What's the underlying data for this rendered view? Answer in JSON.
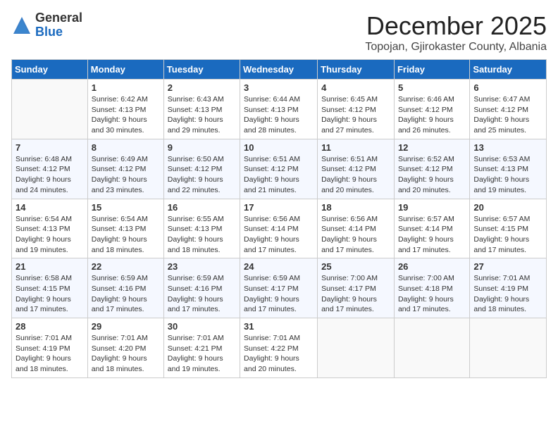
{
  "logo": {
    "general": "General",
    "blue": "Blue"
  },
  "title": "December 2025",
  "location": "Topojan, Gjirokaster County, Albania",
  "headers": [
    "Sunday",
    "Monday",
    "Tuesday",
    "Wednesday",
    "Thursday",
    "Friday",
    "Saturday"
  ],
  "weeks": [
    [
      {
        "day": "",
        "sunrise": "",
        "sunset": "",
        "daylight": ""
      },
      {
        "day": "1",
        "sunrise": "Sunrise: 6:42 AM",
        "sunset": "Sunset: 4:13 PM",
        "daylight": "Daylight: 9 hours and 30 minutes."
      },
      {
        "day": "2",
        "sunrise": "Sunrise: 6:43 AM",
        "sunset": "Sunset: 4:13 PM",
        "daylight": "Daylight: 9 hours and 29 minutes."
      },
      {
        "day": "3",
        "sunrise": "Sunrise: 6:44 AM",
        "sunset": "Sunset: 4:13 PM",
        "daylight": "Daylight: 9 hours and 28 minutes."
      },
      {
        "day": "4",
        "sunrise": "Sunrise: 6:45 AM",
        "sunset": "Sunset: 4:12 PM",
        "daylight": "Daylight: 9 hours and 27 minutes."
      },
      {
        "day": "5",
        "sunrise": "Sunrise: 6:46 AM",
        "sunset": "Sunset: 4:12 PM",
        "daylight": "Daylight: 9 hours and 26 minutes."
      },
      {
        "day": "6",
        "sunrise": "Sunrise: 6:47 AM",
        "sunset": "Sunset: 4:12 PM",
        "daylight": "Daylight: 9 hours and 25 minutes."
      }
    ],
    [
      {
        "day": "7",
        "sunrise": "Sunrise: 6:48 AM",
        "sunset": "Sunset: 4:12 PM",
        "daylight": "Daylight: 9 hours and 24 minutes."
      },
      {
        "day": "8",
        "sunrise": "Sunrise: 6:49 AM",
        "sunset": "Sunset: 4:12 PM",
        "daylight": "Daylight: 9 hours and 23 minutes."
      },
      {
        "day": "9",
        "sunrise": "Sunrise: 6:50 AM",
        "sunset": "Sunset: 4:12 PM",
        "daylight": "Daylight: 9 hours and 22 minutes."
      },
      {
        "day": "10",
        "sunrise": "Sunrise: 6:51 AM",
        "sunset": "Sunset: 4:12 PM",
        "daylight": "Daylight: 9 hours and 21 minutes."
      },
      {
        "day": "11",
        "sunrise": "Sunrise: 6:51 AM",
        "sunset": "Sunset: 4:12 PM",
        "daylight": "Daylight: 9 hours and 20 minutes."
      },
      {
        "day": "12",
        "sunrise": "Sunrise: 6:52 AM",
        "sunset": "Sunset: 4:12 PM",
        "daylight": "Daylight: 9 hours and 20 minutes."
      },
      {
        "day": "13",
        "sunrise": "Sunrise: 6:53 AM",
        "sunset": "Sunset: 4:13 PM",
        "daylight": "Daylight: 9 hours and 19 minutes."
      }
    ],
    [
      {
        "day": "14",
        "sunrise": "Sunrise: 6:54 AM",
        "sunset": "Sunset: 4:13 PM",
        "daylight": "Daylight: 9 hours and 19 minutes."
      },
      {
        "day": "15",
        "sunrise": "Sunrise: 6:54 AM",
        "sunset": "Sunset: 4:13 PM",
        "daylight": "Daylight: 9 hours and 18 minutes."
      },
      {
        "day": "16",
        "sunrise": "Sunrise: 6:55 AM",
        "sunset": "Sunset: 4:13 PM",
        "daylight": "Daylight: 9 hours and 18 minutes."
      },
      {
        "day": "17",
        "sunrise": "Sunrise: 6:56 AM",
        "sunset": "Sunset: 4:14 PM",
        "daylight": "Daylight: 9 hours and 17 minutes."
      },
      {
        "day": "18",
        "sunrise": "Sunrise: 6:56 AM",
        "sunset": "Sunset: 4:14 PM",
        "daylight": "Daylight: 9 hours and 17 minutes."
      },
      {
        "day": "19",
        "sunrise": "Sunrise: 6:57 AM",
        "sunset": "Sunset: 4:14 PM",
        "daylight": "Daylight: 9 hours and 17 minutes."
      },
      {
        "day": "20",
        "sunrise": "Sunrise: 6:57 AM",
        "sunset": "Sunset: 4:15 PM",
        "daylight": "Daylight: 9 hours and 17 minutes."
      }
    ],
    [
      {
        "day": "21",
        "sunrise": "Sunrise: 6:58 AM",
        "sunset": "Sunset: 4:15 PM",
        "daylight": "Daylight: 9 hours and 17 minutes."
      },
      {
        "day": "22",
        "sunrise": "Sunrise: 6:59 AM",
        "sunset": "Sunset: 4:16 PM",
        "daylight": "Daylight: 9 hours and 17 minutes."
      },
      {
        "day": "23",
        "sunrise": "Sunrise: 6:59 AM",
        "sunset": "Sunset: 4:16 PM",
        "daylight": "Daylight: 9 hours and 17 minutes."
      },
      {
        "day": "24",
        "sunrise": "Sunrise: 6:59 AM",
        "sunset": "Sunset: 4:17 PM",
        "daylight": "Daylight: 9 hours and 17 minutes."
      },
      {
        "day": "25",
        "sunrise": "Sunrise: 7:00 AM",
        "sunset": "Sunset: 4:17 PM",
        "daylight": "Daylight: 9 hours and 17 minutes."
      },
      {
        "day": "26",
        "sunrise": "Sunrise: 7:00 AM",
        "sunset": "Sunset: 4:18 PM",
        "daylight": "Daylight: 9 hours and 17 minutes."
      },
      {
        "day": "27",
        "sunrise": "Sunrise: 7:01 AM",
        "sunset": "Sunset: 4:19 PM",
        "daylight": "Daylight: 9 hours and 18 minutes."
      }
    ],
    [
      {
        "day": "28",
        "sunrise": "Sunrise: 7:01 AM",
        "sunset": "Sunset: 4:19 PM",
        "daylight": "Daylight: 9 hours and 18 minutes."
      },
      {
        "day": "29",
        "sunrise": "Sunrise: 7:01 AM",
        "sunset": "Sunset: 4:20 PM",
        "daylight": "Daylight: 9 hours and 18 minutes."
      },
      {
        "day": "30",
        "sunrise": "Sunrise: 7:01 AM",
        "sunset": "Sunset: 4:21 PM",
        "daylight": "Daylight: 9 hours and 19 minutes."
      },
      {
        "day": "31",
        "sunrise": "Sunrise: 7:01 AM",
        "sunset": "Sunset: 4:22 PM",
        "daylight": "Daylight: 9 hours and 20 minutes."
      },
      {
        "day": "",
        "sunrise": "",
        "sunset": "",
        "daylight": ""
      },
      {
        "day": "",
        "sunrise": "",
        "sunset": "",
        "daylight": ""
      },
      {
        "day": "",
        "sunrise": "",
        "sunset": "",
        "daylight": ""
      }
    ]
  ]
}
